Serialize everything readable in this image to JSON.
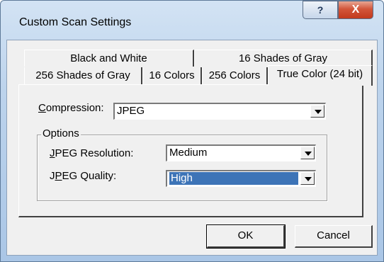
{
  "window": {
    "title": "Custom Scan Settings",
    "help_label": "?",
    "close_label": "X"
  },
  "tabs": {
    "back_row": [
      "Black and White",
      "16 Shades of Gray"
    ],
    "front_row": [
      "256 Shades of Gray",
      "16 Colors",
      "256 Colors"
    ],
    "active": "True Color (24 bit)"
  },
  "compression": {
    "label_u": "C",
    "label_rest": "ompression:",
    "value": "JPEG"
  },
  "options": {
    "legend": "Options",
    "resolution": {
      "label_u": "J",
      "label_rest": "PEG Resolution:",
      "value": "Medium"
    },
    "quality": {
      "label_pre": "J",
      "label_u": "P",
      "label_rest": "EG Quality:",
      "value": "High"
    }
  },
  "buttons": {
    "ok": "OK",
    "cancel": "Cancel"
  }
}
